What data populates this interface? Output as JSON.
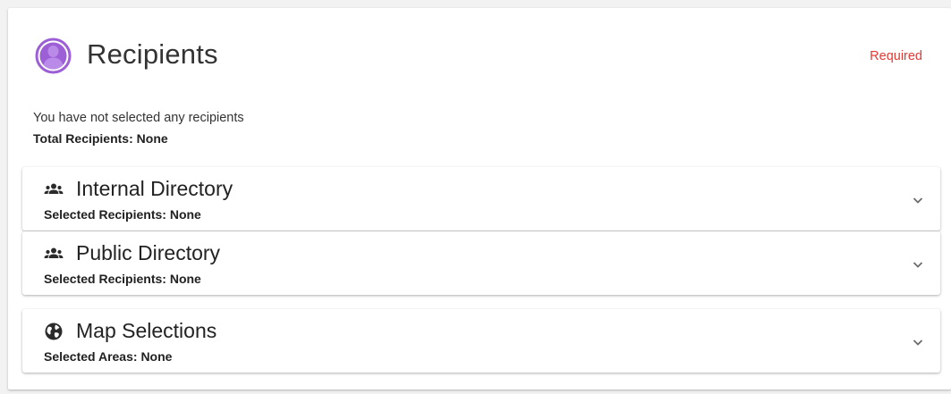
{
  "header": {
    "title": "Recipients",
    "required_label": "Required",
    "icon": "person-circle-icon",
    "icon_color": "#9c5fd6"
  },
  "summary": {
    "status_text": "You have not selected any recipients",
    "total_label": "Total Recipients:",
    "total_value": "None"
  },
  "panels": [
    {
      "title": "Internal Directory",
      "icon": "group-icon",
      "selected_label": "Selected Recipients:",
      "selected_value": "None"
    },
    {
      "title": "Public Directory",
      "icon": "group-icon",
      "selected_label": "Selected Recipients:",
      "selected_value": "None"
    },
    {
      "title": "Map Selections",
      "icon": "globe-icon",
      "selected_label": "Selected Areas:",
      "selected_value": "None"
    }
  ],
  "colors": {
    "required": "#e53935",
    "accent": "#9c5fd6"
  }
}
